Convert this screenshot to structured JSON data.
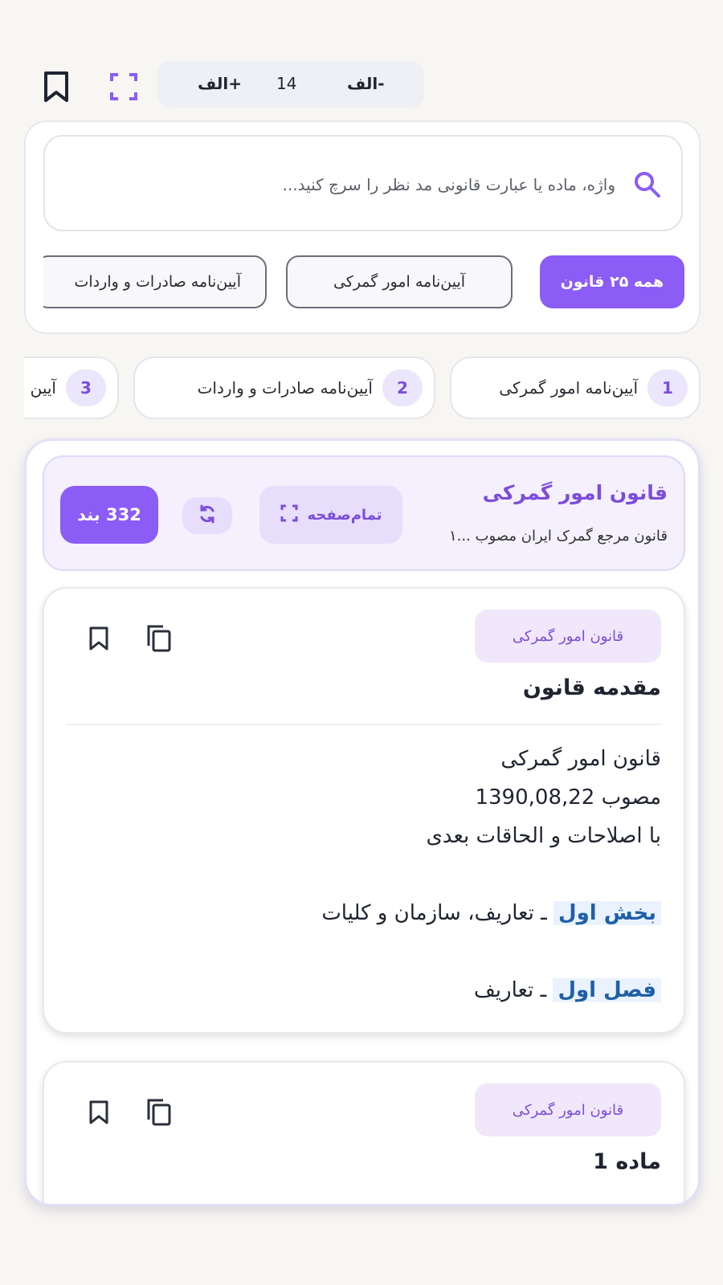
{
  "toolbar": {
    "font_increase": "الف+",
    "font_size": "14",
    "font_decrease": "الف-"
  },
  "search": {
    "placeholder": "واژه، ماده یا عبارت قانونی مد نظر را سرچ کنید..."
  },
  "filters": [
    {
      "label": "همه ۲۵ قانون",
      "active": true
    },
    {
      "label": "آیین‌نامه امور گمرکی",
      "active": false
    },
    {
      "label": "آیین‌نامه صادرات و واردات",
      "active": false
    }
  ],
  "result_tabs": [
    {
      "num": "1",
      "label": "آیین‌نامه امور گمرکی"
    },
    {
      "num": "2",
      "label": "آیین‌نامه صادرات و واردات"
    },
    {
      "num": "3",
      "label": "آیین"
    }
  ],
  "law_header": {
    "title": "قانون امور گمرکی",
    "subtitle": "قانون مرجع گمرک ایران مصوب ...۱",
    "fullpage_label": "تمام‌صفحه",
    "count_label": "332 بند"
  },
  "articles": [
    {
      "badge": "قانون امور گمرکی",
      "title": "مقدمه قانون",
      "body_lines": [
        "قانون امور گمرکی",
        "مصوب 1390,08,22",
        "با اصلاحات و الحاقات بعدی"
      ],
      "section_label": "بخش اول",
      "section_text": " ـ تعاریف، سازمان و کلیات",
      "chapter_label": "فصل اول",
      "chapter_text": " ـ تعاریف"
    },
    {
      "badge": "قانون امور گمرکی",
      "title": "ماده 1"
    }
  ],
  "colors": {
    "accent": "#8b5cf6",
    "accent_text": "#7c4ddb",
    "highlight_bg": "#eaf3fd",
    "highlight_text": "#1f5fa8"
  }
}
